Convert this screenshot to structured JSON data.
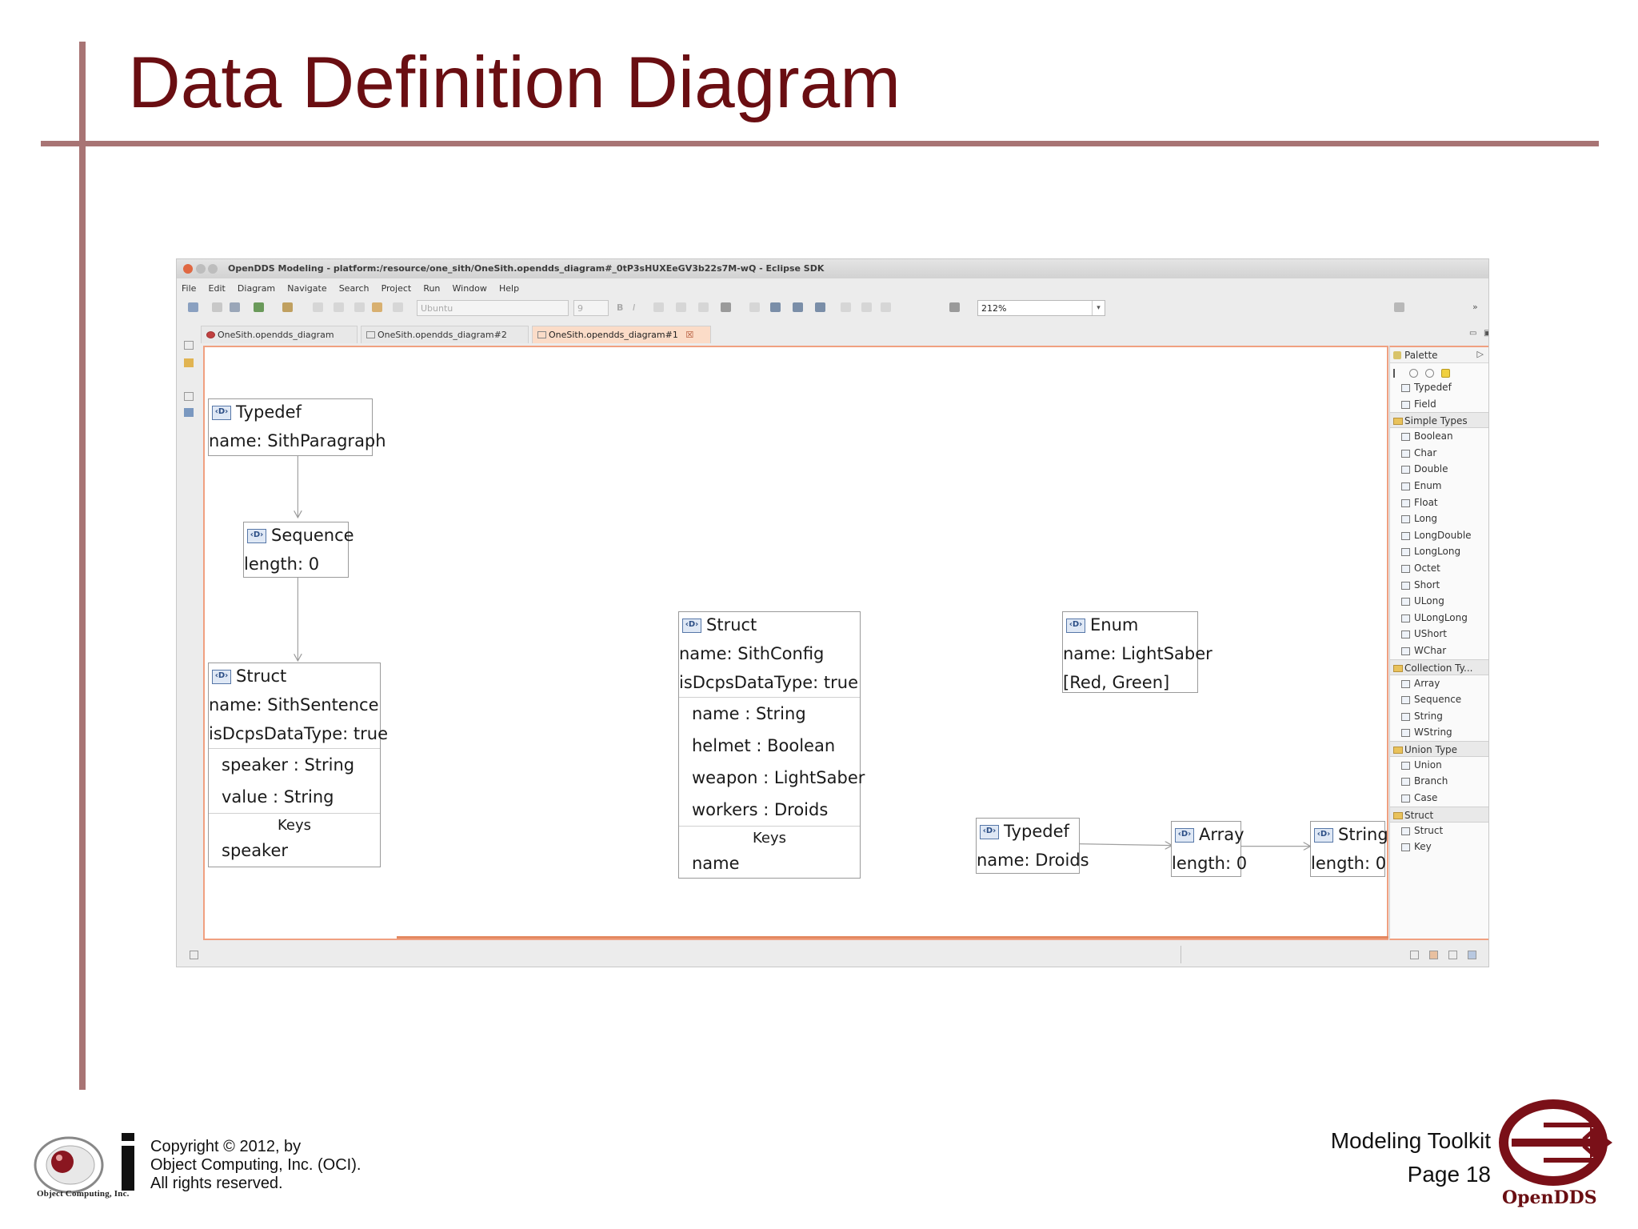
{
  "slide": {
    "title": "Data Definition Diagram",
    "footer": {
      "copyright_lines": [
        "Copyright © 2012, by",
        "Object Computing, Inc. (OCI).",
        "All rights reserved."
      ],
      "oci_caption": "Object Computing, Inc.",
      "toolkit": "Modeling Toolkit",
      "page": "Page 18",
      "opendds": "OpenDDS"
    }
  },
  "window": {
    "title": "OpenDDS Modeling - platform:/resource/one_sith/OneSith.opendds_diagram#_0tP3sHUXEeGV3b22s7M-wQ - Eclipse SDK",
    "menu": [
      "File",
      "Edit",
      "Diagram",
      "Navigate",
      "Search",
      "Project",
      "Run",
      "Window",
      "Help"
    ],
    "toolbar": {
      "font_combo": "Ubuntu",
      "size_combo": "9",
      "zoom": "212%",
      "bold": "B",
      "italic": "I"
    },
    "tabs": [
      {
        "label": "OneSith.opendds_diagram",
        "active": false
      },
      {
        "label": "OneSith.opendds_diagram#2",
        "active": false
      },
      {
        "label": "OneSith.opendds_diagram#1",
        "active": true,
        "close": "☒"
      }
    ]
  },
  "diagram": {
    "typedef_sith": {
      "type": "Typedef",
      "name": "name: SithParagraph"
    },
    "sequence": {
      "type": "Sequence",
      "length": "length: 0"
    },
    "struct_sentence": {
      "type": "Struct",
      "name": "name: SithSentence",
      "dcps": "isDcpsDataType: true",
      "fields": [
        "speaker : String",
        "value : String"
      ],
      "keys_title": "Keys",
      "keys": [
        "speaker"
      ]
    },
    "struct_config": {
      "type": "Struct",
      "name": "name: SithConfig",
      "dcps": "isDcpsDataType: true",
      "fields": [
        "name : String",
        "helmet : Boolean",
        "weapon : LightSaber",
        "workers : Droids"
      ],
      "keys_title": "Keys",
      "keys": [
        "name"
      ]
    },
    "enum_saber": {
      "type": "Enum",
      "name": "name: LightSaber",
      "values": "[Red, Green]"
    },
    "typedef_droids": {
      "type": "Typedef",
      "name": "name: Droids"
    },
    "array": {
      "type": "Array",
      "length": "length: 0"
    },
    "string": {
      "type": "String",
      "length": "length: 0"
    }
  },
  "palette": {
    "title": "Palette",
    "top_items": [
      "Typedef",
      "Field"
    ],
    "drawers": [
      {
        "label": "Simple Types",
        "items": [
          "Boolean",
          "Char",
          "Double",
          "Enum",
          "Float",
          "Long",
          "LongDouble",
          "LongLong",
          "Octet",
          "Short",
          "ULong",
          "ULongLong",
          "UShort",
          "WChar"
        ]
      },
      {
        "label": "Collection Ty...",
        "items": [
          "Array",
          "Sequence",
          "String",
          "WString"
        ]
      },
      {
        "label": "Union Type",
        "items": [
          "Union",
          "Branch",
          "Case"
        ]
      },
      {
        "label": "Struct",
        "items": [
          "Struct",
          "Key"
        ]
      }
    ]
  },
  "colors": {
    "title": "#6a0e12",
    "rule": "#a87474",
    "editor_border": "#f0a080",
    "active_tab": "#fbdcc8"
  },
  "icons": [
    "close-icon",
    "minimize-icon",
    "maximize-icon",
    "new-icon",
    "save-icon",
    "print-icon",
    "search-icon",
    "palette-icon",
    "folder-icon",
    "type-icon"
  ]
}
